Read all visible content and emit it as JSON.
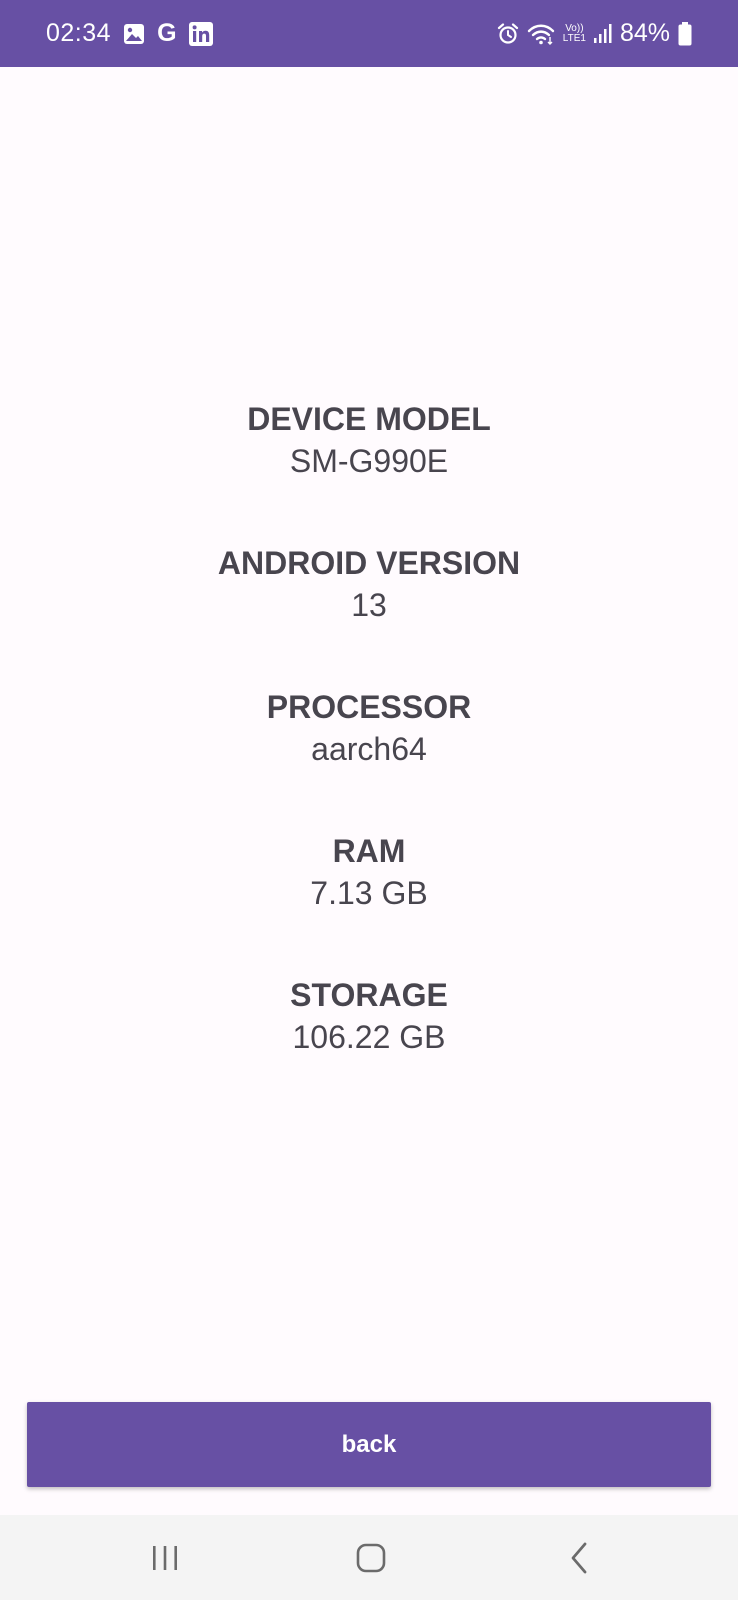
{
  "status_bar": {
    "time": "02:34",
    "battery": "84%",
    "volte_top": "Vo))",
    "volte_bottom": "LTE1",
    "google_letter": "G",
    "notification_icons": [
      "gallery-icon",
      "google-icon",
      "linkedin-icon"
    ],
    "system_icons": [
      "alarm-icon",
      "wifi-icon",
      "volte-icon",
      "signal-icon",
      "battery-icon"
    ],
    "background_color": "#6750a4"
  },
  "info": [
    {
      "label": "DEVICE MODEL",
      "value": "SM-G990E"
    },
    {
      "label": "ANDROID VERSION",
      "value": "13"
    },
    {
      "label": "PROCESSOR",
      "value": "aarch64"
    },
    {
      "label": "RAM",
      "value": "7.13 GB"
    },
    {
      "label": "STORAGE",
      "value": "106.22 GB"
    }
  ],
  "back_button": {
    "label": "back",
    "color": "#6750a4"
  },
  "nav_bar": {
    "buttons": [
      "recents-icon",
      "home-icon",
      "back-icon"
    ]
  },
  "colors": {
    "accent": "#6750a4",
    "background": "#fffbfe",
    "text": "#48454e"
  }
}
